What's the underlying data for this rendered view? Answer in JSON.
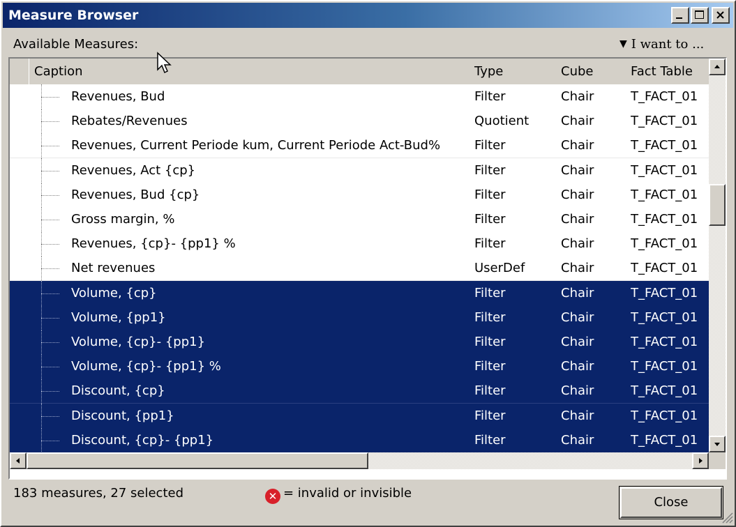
{
  "window": {
    "title": "Measure Browser"
  },
  "toolbar": {
    "available_label": "Available Measures:",
    "i_want_to_label": "I want to ..."
  },
  "grid": {
    "columns": {
      "caption": "Caption",
      "type": "Type",
      "cube": "Cube",
      "fact_table": "Fact Table"
    },
    "rows": [
      {
        "caption": "Revenues, Bud",
        "type": "Filter",
        "cube": "Chair",
        "fact_table": "T_FACT_01",
        "selected": false
      },
      {
        "caption": "Rebates/Revenues",
        "type": "Quotient",
        "cube": "Chair",
        "fact_table": "T_FACT_01",
        "selected": false
      },
      {
        "caption": "Revenues, Current Periode kum, Current Periode Act-Bud%",
        "type": "Filter",
        "cube": "Chair",
        "fact_table": "T_FACT_01",
        "selected": false
      },
      {
        "caption": "Revenues, Act {cp}",
        "type": "Filter",
        "cube": "Chair",
        "fact_table": "T_FACT_01",
        "selected": false
      },
      {
        "caption": "Revenues, Bud {cp}",
        "type": "Filter",
        "cube": "Chair",
        "fact_table": "T_FACT_01",
        "selected": false
      },
      {
        "caption": "Gross margin, %",
        "type": "Filter",
        "cube": "Chair",
        "fact_table": "T_FACT_01",
        "selected": false
      },
      {
        "caption": "Revenues, {cp}-  {pp1} %",
        "type": "Filter",
        "cube": "Chair",
        "fact_table": "T_FACT_01",
        "selected": false
      },
      {
        "caption": "Net revenues",
        "type": "UserDef",
        "cube": "Chair",
        "fact_table": "T_FACT_01",
        "selected": false
      },
      {
        "caption": "Volume, {cp}",
        "type": "Filter",
        "cube": "Chair",
        "fact_table": "T_FACT_01",
        "selected": true
      },
      {
        "caption": "Volume, {pp1}",
        "type": "Filter",
        "cube": "Chair",
        "fact_table": "T_FACT_01",
        "selected": true
      },
      {
        "caption": "Volume, {cp}-  {pp1}",
        "type": "Filter",
        "cube": "Chair",
        "fact_table": "T_FACT_01",
        "selected": true
      },
      {
        "caption": "Volume, {cp}-  {pp1} %",
        "type": "Filter",
        "cube": "Chair",
        "fact_table": "T_FACT_01",
        "selected": true
      },
      {
        "caption": "Discount, {cp}",
        "type": "Filter",
        "cube": "Chair",
        "fact_table": "T_FACT_01",
        "selected": true
      },
      {
        "caption": "Discount, {pp1}",
        "type": "Filter",
        "cube": "Chair",
        "fact_table": "T_FACT_01",
        "selected": true
      },
      {
        "caption": "Discount, {cp}-  {pp1}",
        "type": "Filter",
        "cube": "Chair",
        "fact_table": "T_FACT_01",
        "selected": true
      }
    ]
  },
  "status": {
    "summary": "183 measures, 27 selected",
    "legend_text": "= invalid or invisible",
    "legend_icon": "error-x-icon"
  },
  "buttons": {
    "close_label": "Close"
  },
  "colors": {
    "selection": "#0a246a",
    "window_bg": "#d4d0c8",
    "error_icon": "#d8202a"
  }
}
